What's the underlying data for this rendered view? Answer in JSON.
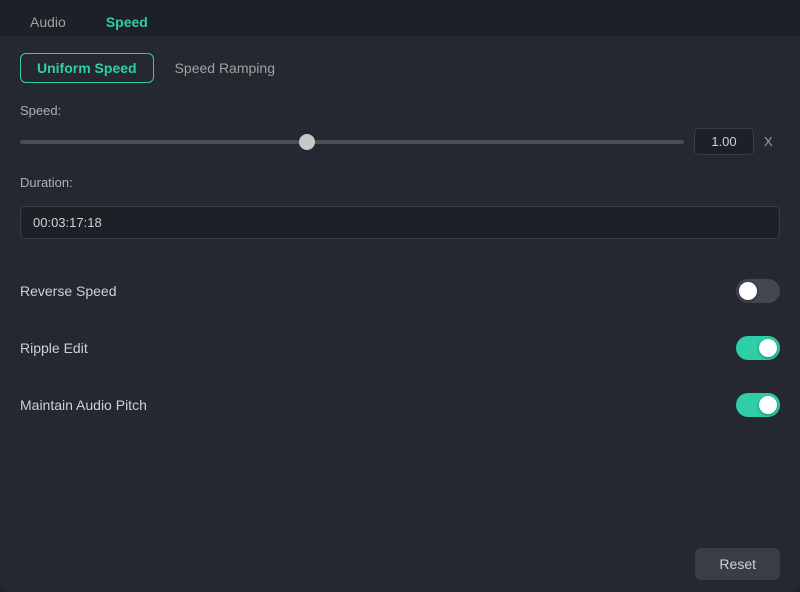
{
  "topTabs": [
    {
      "id": "audio",
      "label": "Audio",
      "active": false
    },
    {
      "id": "speed",
      "label": "Speed",
      "active": true
    }
  ],
  "subTabs": [
    {
      "id": "uniform-speed",
      "label": "Uniform Speed",
      "active": true
    },
    {
      "id": "speed-ramping",
      "label": "Speed Ramping",
      "active": false
    }
  ],
  "speedSection": {
    "label": "Speed:",
    "sliderValue": 43,
    "valueBox": "1.00",
    "xLabel": "X"
  },
  "durationSection": {
    "label": "Duration:",
    "value": "00:03:17:18"
  },
  "toggles": [
    {
      "id": "reverse-speed",
      "label": "Reverse Speed",
      "on": false
    },
    {
      "id": "ripple-edit",
      "label": "Ripple Edit",
      "on": true
    },
    {
      "id": "maintain-audio-pitch",
      "label": "Maintain Audio Pitch",
      "on": true
    }
  ],
  "resetButton": {
    "label": "Reset"
  }
}
